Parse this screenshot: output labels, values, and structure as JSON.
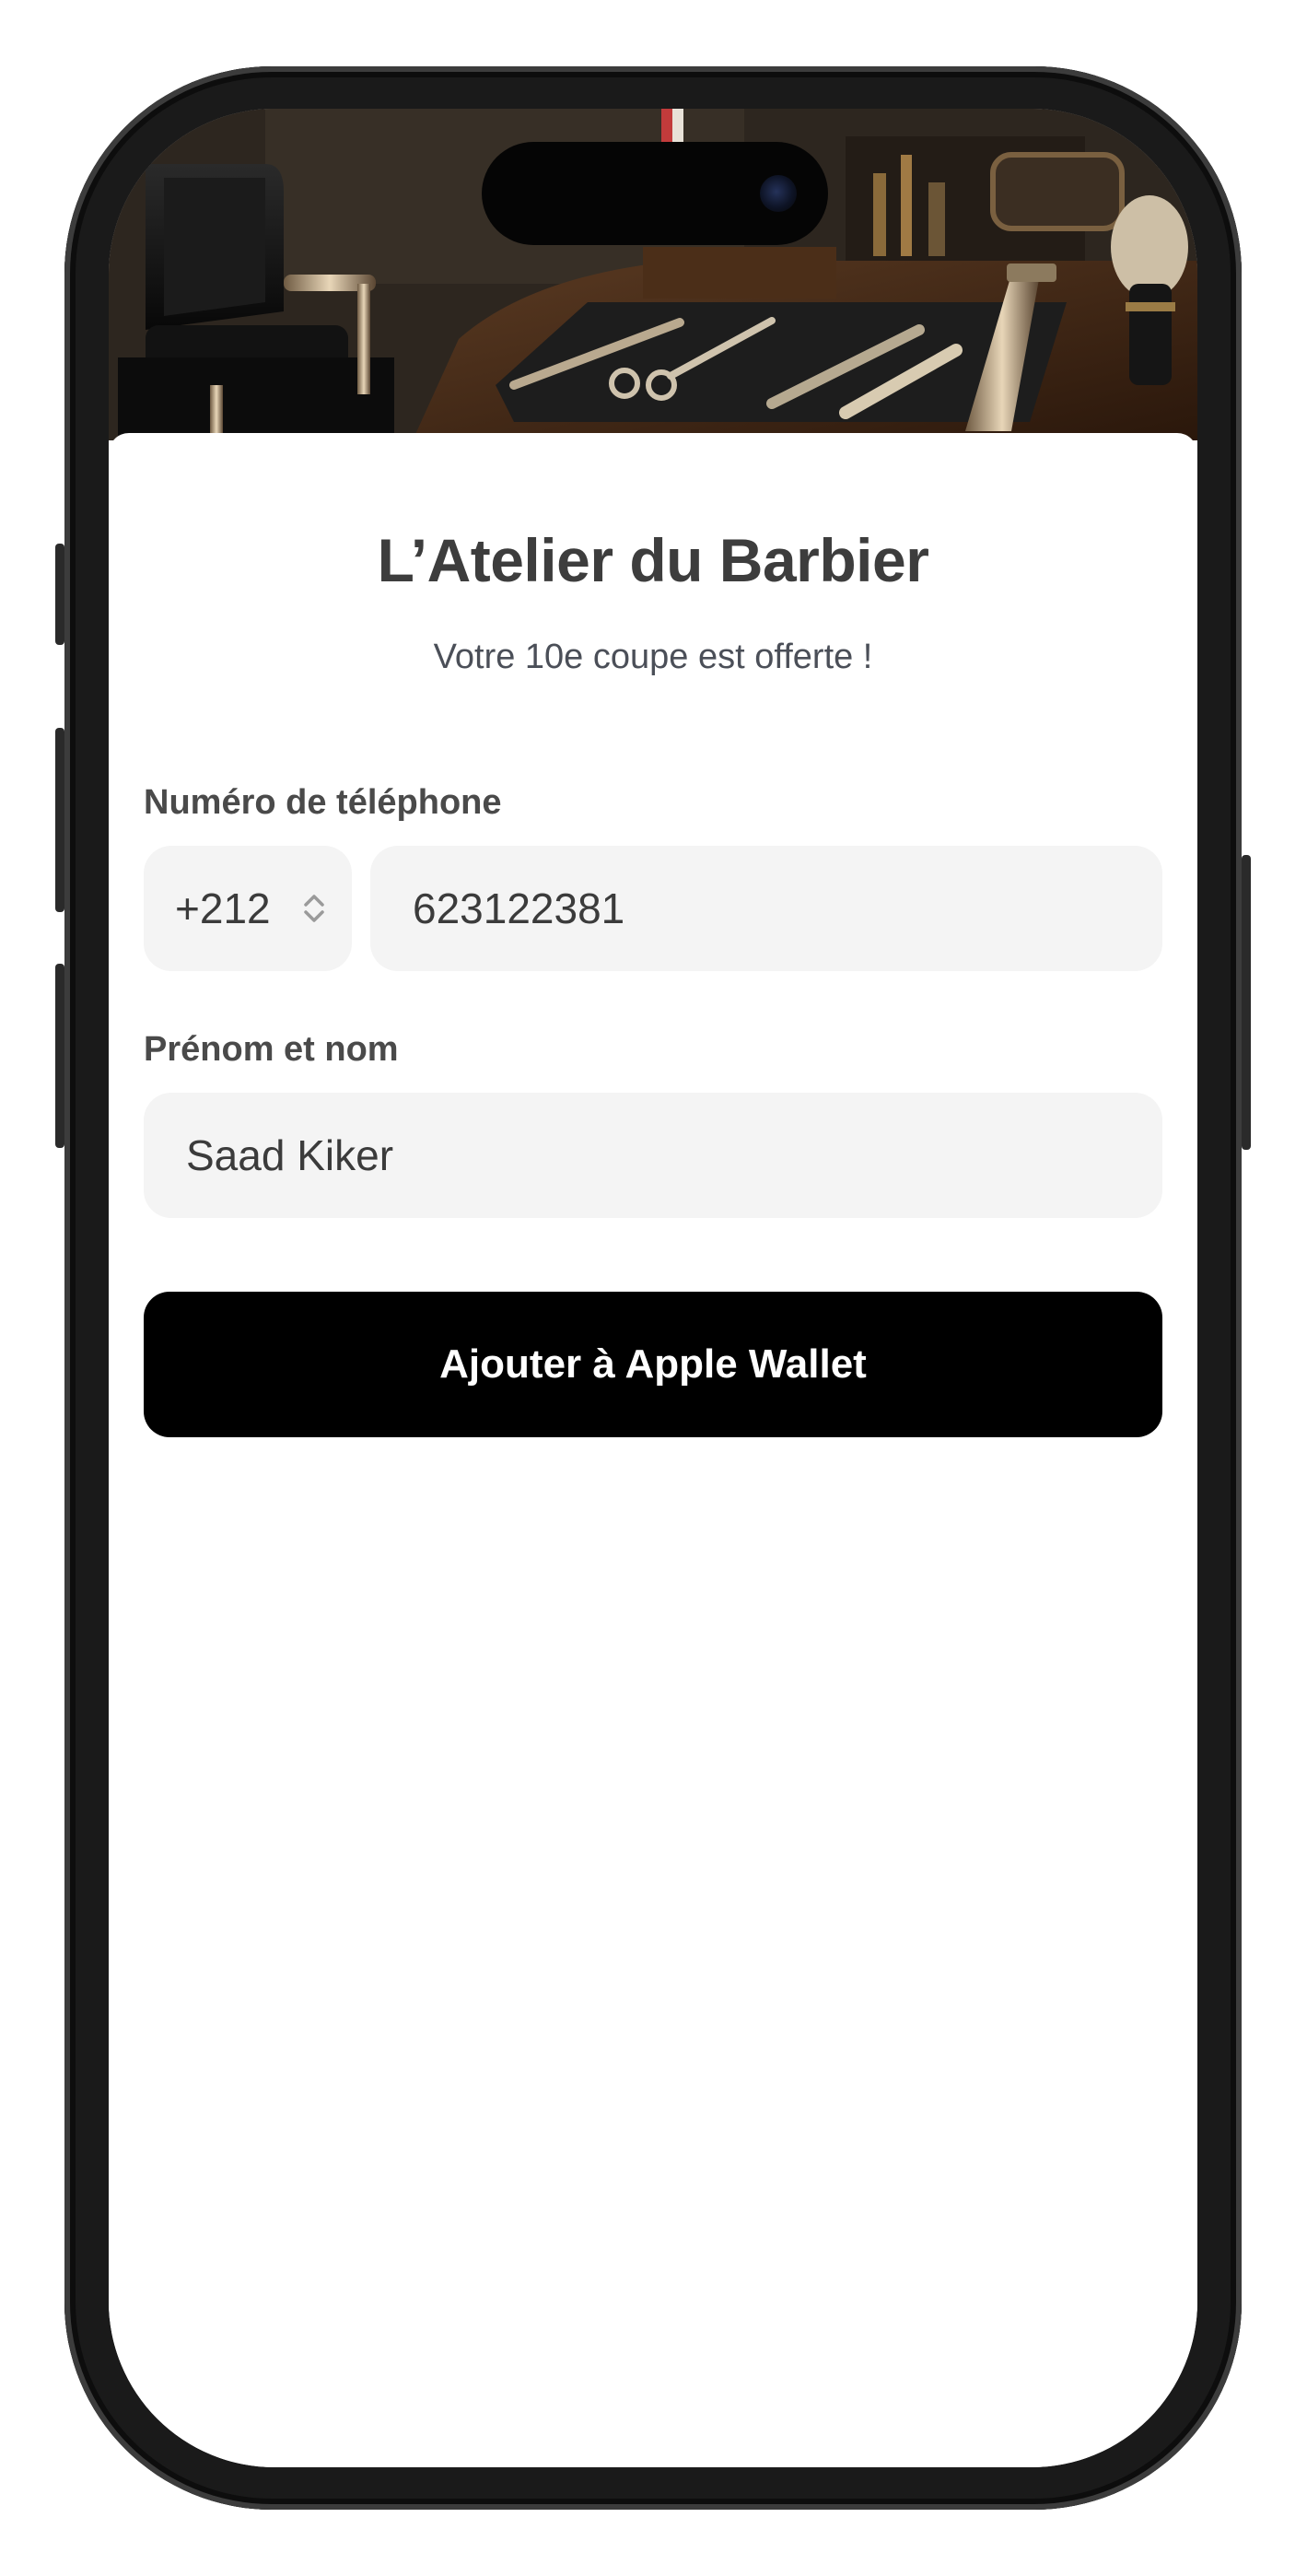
{
  "app": {
    "title": "L’Atelier du Barbier",
    "subtitle": "Votre 10e coupe est offerte !"
  },
  "form": {
    "phone_label": "Numéro de téléphone",
    "country_code": "+212",
    "phone_value": "623122381",
    "name_label": "Prénom et nom",
    "name_value": "Saad Kiker"
  },
  "cta": {
    "label": "Ajouter à Apple Wallet"
  },
  "colors": {
    "button_bg": "#000000",
    "input_bg": "#f4f4f4",
    "title_color": "#3d3d3d"
  },
  "icons": {
    "country_code_select": "chevron-up-down-icon",
    "camera": "front-camera-icon"
  }
}
